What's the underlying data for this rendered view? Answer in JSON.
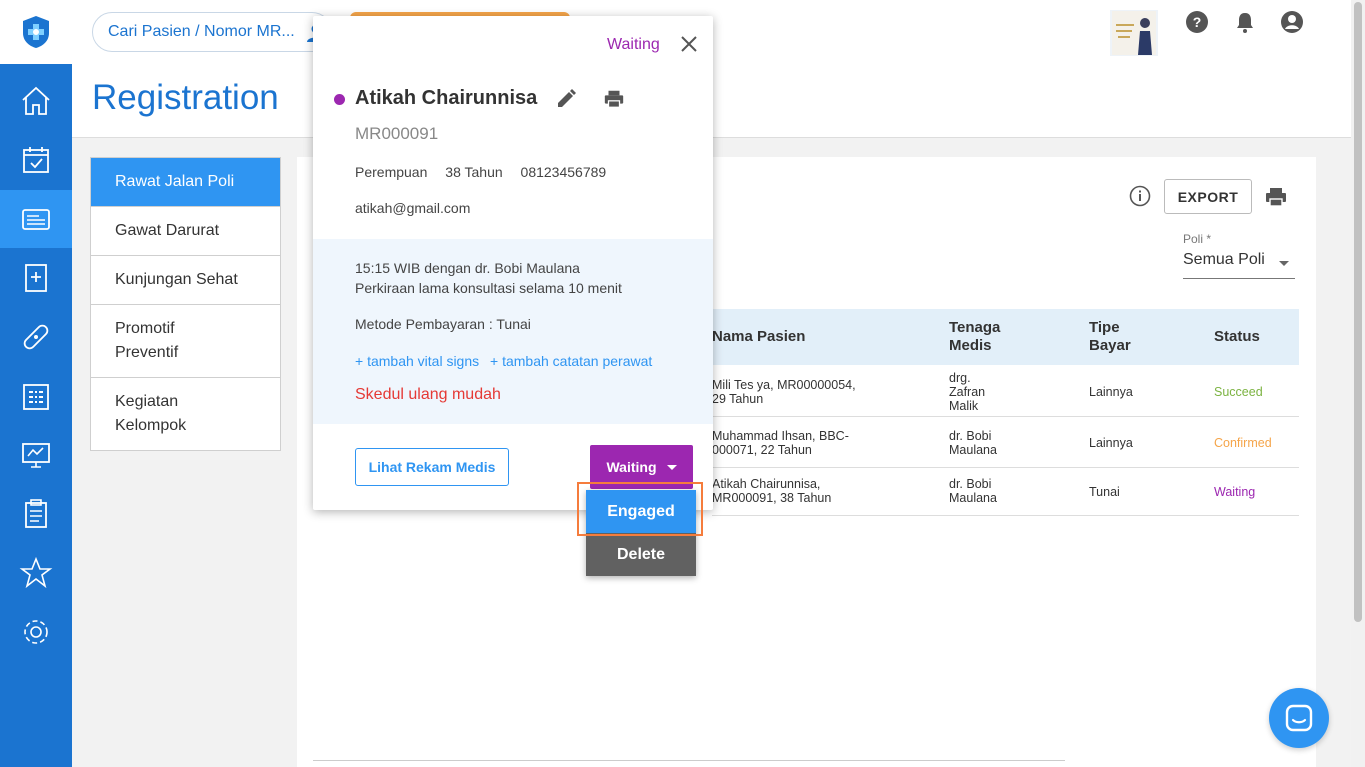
{
  "search": {
    "placeholder": "Cari Pasien / Nomor MR..."
  },
  "header": {
    "title": "Registration"
  },
  "left_menu": [
    {
      "label": "Rawat Jalan Poli"
    },
    {
      "label": "Gawat Darurat"
    },
    {
      "label": "Kunjungan Sehat"
    },
    {
      "label": "Promotif Preventif"
    },
    {
      "label": "Kegiatan Kelompok"
    }
  ],
  "toolbar": {
    "export_label": "EXPORT"
  },
  "poli": {
    "label": "Poli *",
    "value": "Semua Poli"
  },
  "table": {
    "headers": {
      "nama": "Nama Pasien",
      "tenaga": "Tenaga Medis",
      "tipe": "Tipe Bayar",
      "status": "Status"
    },
    "rows": [
      {
        "nama": "Mili Tes ya, MR00000054, 29 Tahun",
        "tenaga": "drg. Zafran Malik",
        "tipe": "Lainnya",
        "status": "Succeed",
        "status_color": "#7cb342"
      },
      {
        "nama": "Muhammad Ihsan, BBC-000071, 22 Tahun",
        "tenaga": "dr. Bobi Maulana",
        "tipe": "Lainnya",
        "status": "Confirmed",
        "status_color": "#f5a54a"
      },
      {
        "nama": "Atikah Chairunnisa, MR000091, 38 Tahun",
        "tenaga": "dr. Bobi Maulana",
        "tipe": "Tunai",
        "status": "Waiting",
        "status_color": "#9c27b0"
      }
    ]
  },
  "popup": {
    "status": "Waiting",
    "name": "Atikah Chairunnisa",
    "mr": "MR000091",
    "gender": "Perempuan",
    "age": "38 Tahun",
    "phone": "08123456789",
    "email": "atikah@gmail.com",
    "schedule": "15:15 WIB dengan dr. Bobi Maulana",
    "duration": "Perkiraan lama konsultasi selama 10 menit",
    "payment": "Metode Pembayaran : Tunai",
    "add_vital": "+ tambah vital signs",
    "add_note": "+ tambah catatan perawat",
    "reschedule": "Skedul ulang mudah",
    "rekam_button": "Lihat Rekam Medis",
    "status_button": "Waiting"
  },
  "dropdown": {
    "engaged": "Engaged",
    "delete": "Delete"
  },
  "colors": {
    "brand": "#1b74d0",
    "accent": "#2f95f2",
    "waiting": "#9c27b0"
  }
}
